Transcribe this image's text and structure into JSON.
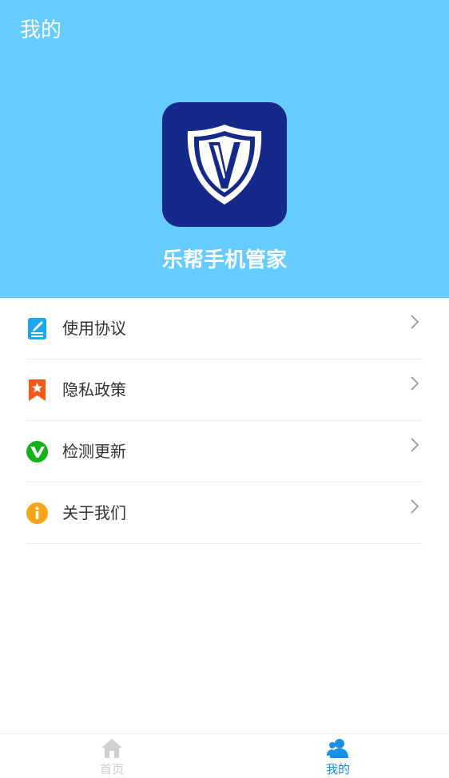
{
  "header": {
    "title": "我的",
    "app_name": "乐帮手机管家",
    "logo_icon": "shield-v-logo",
    "background_color": "#66ccff",
    "logo_color": "#15298a"
  },
  "menu": {
    "items": [
      {
        "label": "使用协议",
        "icon": "document-edit-icon",
        "icon_color": "#1aa7ee"
      },
      {
        "label": "隐私政策",
        "icon": "bookmark-star-icon",
        "icon_color": "#f25a1d"
      },
      {
        "label": "检测更新",
        "icon": "v-update-icon",
        "icon_color": "#13b11c"
      },
      {
        "label": "关于我们",
        "icon": "info-icon",
        "icon_color": "#f9a31a"
      }
    ],
    "chevron_icon": "chevron-right-icon"
  },
  "tabbar": {
    "tabs": [
      {
        "label": "首页",
        "icon": "home-icon",
        "active": false,
        "color": "#cccccc"
      },
      {
        "label": "我的",
        "icon": "user-icon",
        "active": true,
        "color": "#1a8fe8"
      }
    ]
  }
}
